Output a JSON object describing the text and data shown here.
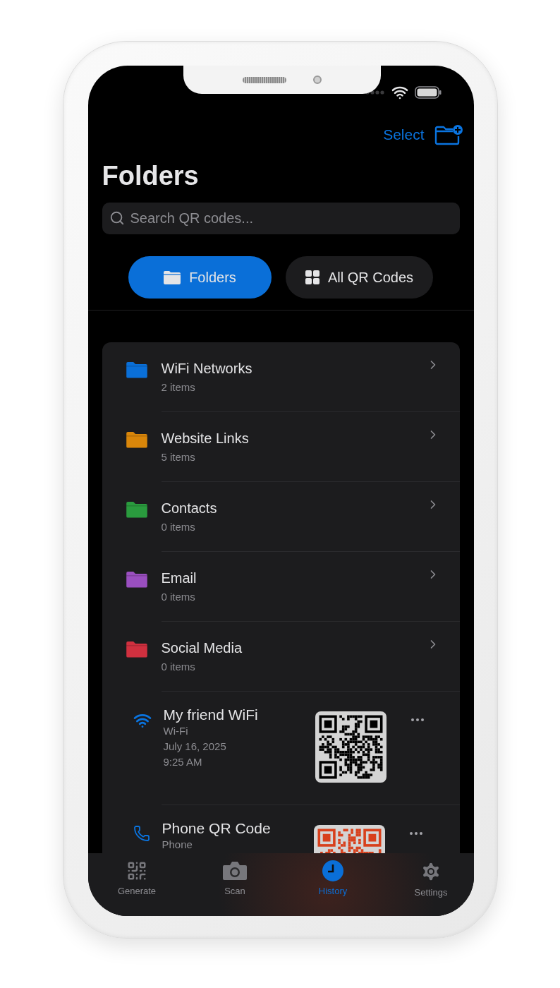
{
  "header": {
    "select_label": "Select"
  },
  "title": "Folders",
  "search": {
    "placeholder": "Search QR codes..."
  },
  "view_tabs": [
    {
      "label": "Folders",
      "kind": "folders",
      "selected": true
    },
    {
      "label": "All QR Codes",
      "kind": "grid",
      "selected": false
    }
  ],
  "folders": [
    {
      "name": "WiFi Networks",
      "count": "2 items",
      "color": "#0a6fd8"
    },
    {
      "name": "Website Links",
      "count": "5 items",
      "color": "#d9860a"
    },
    {
      "name": "Contacts",
      "count": "0 items",
      "color": "#2a9b3e"
    },
    {
      "name": "Email",
      "count": "0 items",
      "color": "#9a4fc0"
    },
    {
      "name": "Social Media",
      "count": "0 items",
      "color": "#d0303f"
    }
  ],
  "codes": [
    {
      "kind": "wifi",
      "title": "My friend WiFi",
      "type": "Wi-Fi",
      "date": "July 16, 2025",
      "time": "9:25 AM",
      "color": "#000000"
    },
    {
      "kind": "phone",
      "title": "Phone QR Code",
      "type": "Phone",
      "color": "#d8401c"
    }
  ],
  "tab_bar": [
    {
      "label": "Generate",
      "kind": "generate",
      "selected": false
    },
    {
      "label": "Scan",
      "kind": "scan",
      "selected": false
    },
    {
      "label": "History",
      "kind": "history",
      "selected": true
    },
    {
      "label": "Settings",
      "kind": "settings",
      "selected": false
    }
  ]
}
